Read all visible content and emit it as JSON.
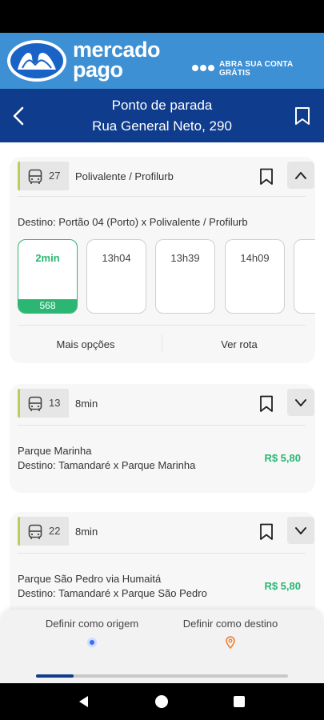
{
  "ad": {
    "brand_line1": "mercado",
    "brand_line2": "pago",
    "cta": "ABRA SUA CONTA GRÁTIS"
  },
  "header": {
    "title_line1": "Ponto de parada",
    "title_line2": "Rua General Neto, 290"
  },
  "routes": [
    {
      "number": "27",
      "name": "Polivalente / Profilurb",
      "destination": "Destino: Portão 04 (Porto) x Polivalente / Profilurb",
      "times": [
        "2min",
        "13h04",
        "13h39",
        "14h09"
      ],
      "active_bus": "568",
      "more_options": "Mais opções",
      "see_route": "Ver rota"
    },
    {
      "number": "13",
      "eta": "8min",
      "line1": "Parque Marinha",
      "line2": "Destino: Tamandaré x Parque Marinha",
      "price": "R$ 5,80"
    },
    {
      "number": "22",
      "eta": "8min",
      "line1": "Parque São Pedro via Humaitá",
      "line2": "Destino: Tamandaré x Parque São Pedro",
      "price": "R$ 5,80"
    }
  ],
  "bottom_sheet": {
    "set_origin": "Definir como origem",
    "set_destination": "Definir como destino",
    "progress": 0.15
  },
  "colors": {
    "header": "#0f3c8c",
    "ad_banner": "#3d90d3",
    "accent_green": "#2bb673",
    "route_stripe": "#b9cf5a"
  }
}
